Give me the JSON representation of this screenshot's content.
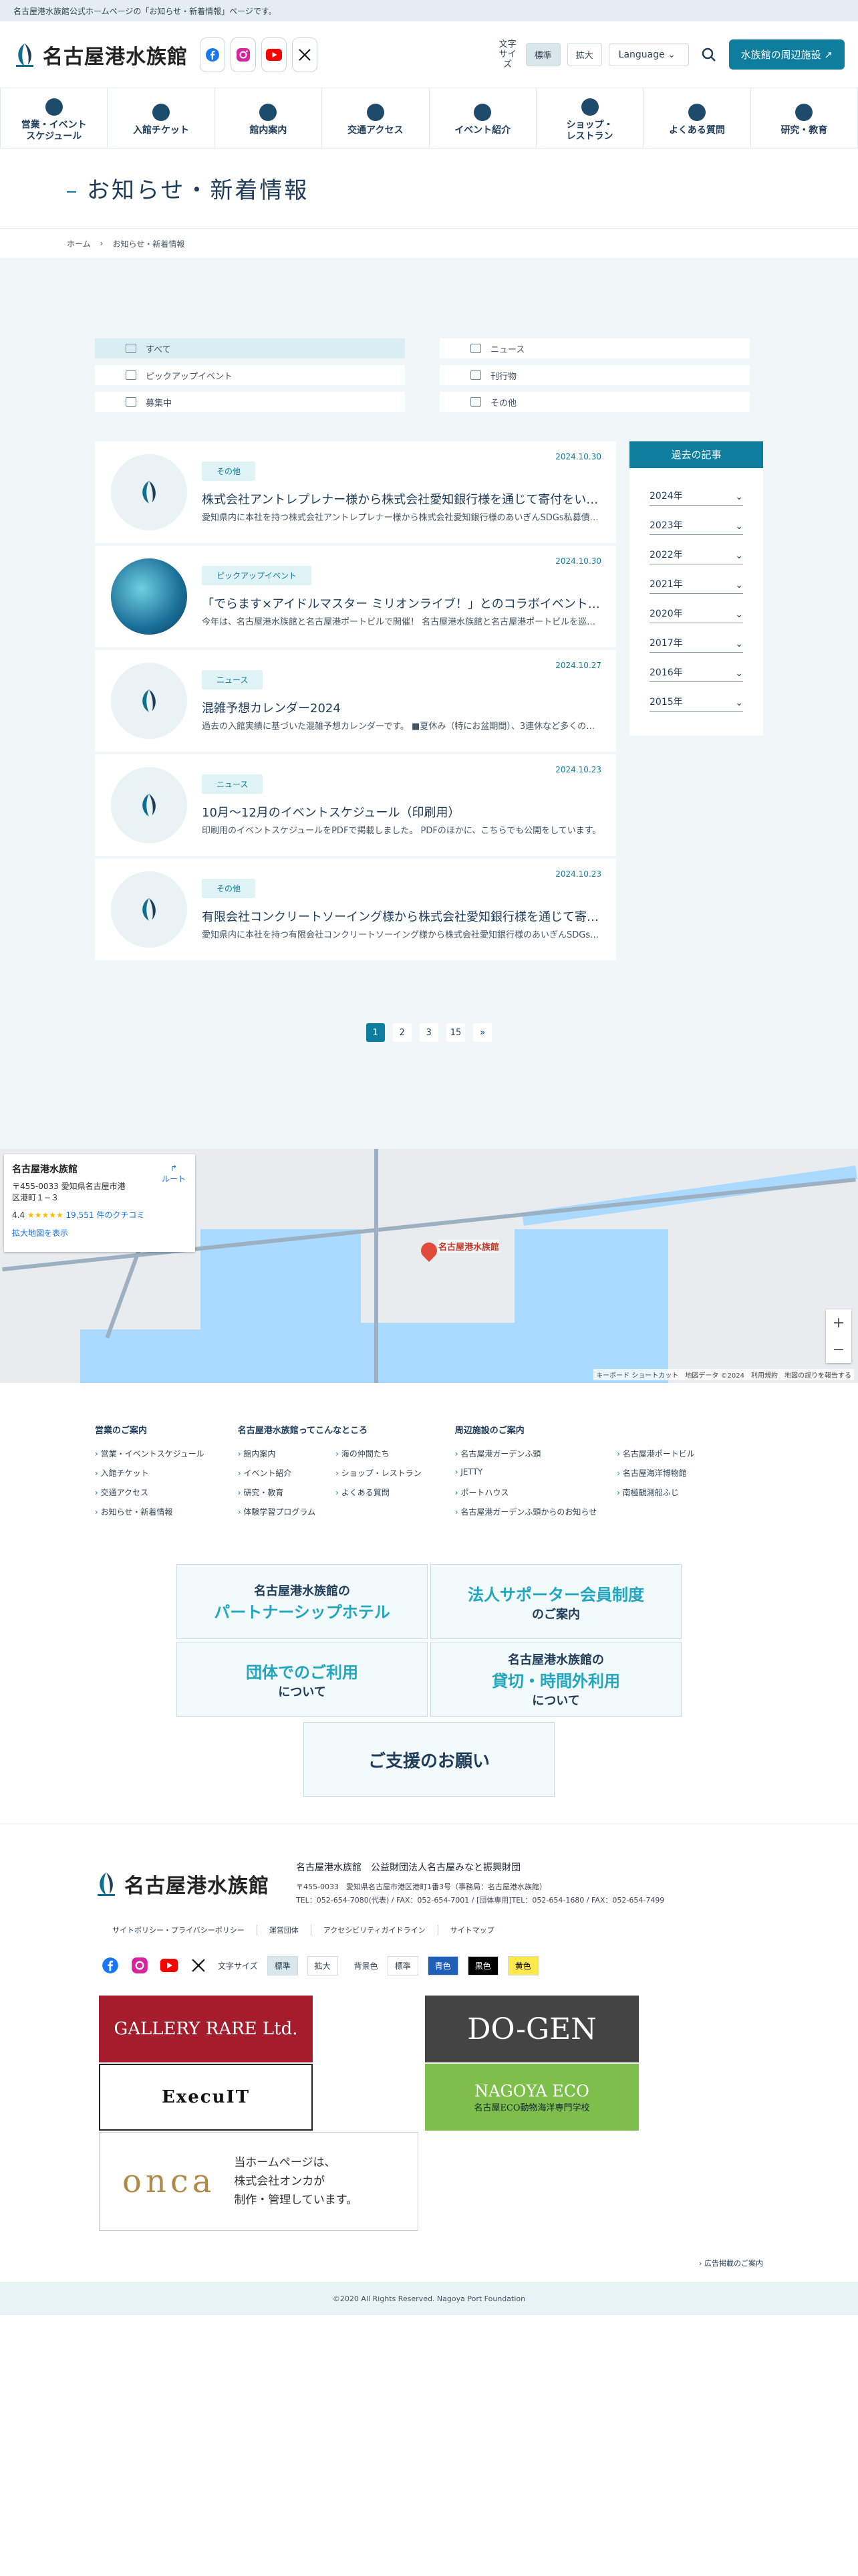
{
  "topbar": "名古屋港水族館公式ホームページの「お知らせ・新着情報」ページです。",
  "header": {
    "logo_text": "名古屋港水族館",
    "font_size_label": "文字サイズ",
    "font_standard": "標準",
    "font_large": "拡大",
    "language": "Language",
    "nearby": "水族館の周辺施設"
  },
  "nav": [
    {
      "label": "営業・イベント\nスケジュール",
      "icon": "clock-icon"
    },
    {
      "label": "入館チケット",
      "icon": "ticket-icon"
    },
    {
      "label": "館内案内",
      "icon": "map-search-icon"
    },
    {
      "label": "交通アクセス",
      "icon": "bus-icon"
    },
    {
      "label": "イベント紹介",
      "icon": "megaphone-icon"
    },
    {
      "label": "ショップ・\nレストラン",
      "icon": "shop-icon"
    },
    {
      "label": "よくある質問",
      "icon": "lightbulb-icon"
    },
    {
      "label": "研究・教育",
      "icon": "globe-icon"
    }
  ],
  "page_title": "お知らせ・新着情報",
  "breadcrumb": {
    "home": "ホーム",
    "current": "お知らせ・新着情報"
  },
  "categories": [
    {
      "label": "すべて",
      "icon": "grid-icon",
      "active": true
    },
    {
      "label": "ニュース",
      "icon": "document-icon",
      "active": false
    },
    {
      "label": "ピックアップイベント",
      "icon": "calendar-icon",
      "active": false
    },
    {
      "label": "刊行物",
      "icon": "book-icon",
      "active": false
    },
    {
      "label": "募集中",
      "icon": "megaphone-icon",
      "active": false
    },
    {
      "label": "その他",
      "icon": "dots-icon",
      "active": false
    }
  ],
  "news": [
    {
      "badge": "その他",
      "date": "2024.10.30",
      "title": "株式会社アントレプレナー様から株式会社愛知銀行様を通じて寄付をいただきました",
      "desc": "愛知県内に本社を持つ株式会社アントレプレナー様から株式会社愛知銀行様のあいぎんSDGs私募債を通じて寄付をいただきました。",
      "photo": false
    },
    {
      "badge": "ピックアップイベント",
      "date": "2024.10.30",
      "title": "「でらます×アイドルマスター ミリオンライブ！」とのコラボイベントを開催します",
      "desc": "今年は、名古屋港水族館と名古屋港ポートビルで開催！ 名古屋港水族館と名古屋港ポートビルを巡るスタンプラリーを実施します。",
      "photo": true
    },
    {
      "badge": "ニュース",
      "date": "2024.10.27",
      "title": "混雑予想カレンダー2024",
      "desc": "過去の入館実績に基づいた混雑予想カレンダーです。 ■夏休み（特にお盆期間）、3連休など多くのお客様にご来館いただく日があります。",
      "photo": false
    },
    {
      "badge": "ニュース",
      "date": "2024.10.23",
      "title": "10月～12月のイベントスケジュール（印刷用）",
      "desc": "印刷用のイベントスケジュールをPDFで掲載しました。 PDFのほかに、こちらでも公開をしています。",
      "photo": false
    },
    {
      "badge": "その他",
      "date": "2024.10.23",
      "title": "有限会社コンクリートソーイング様から株式会社愛知銀行様を通じて寄付をいただきました",
      "desc": "愛知県内に本社を持つ有限会社コンクリートソーイング様から株式会社愛知銀行様のあいぎんSDGs私募債を通じて寄付をいただきました。",
      "photo": false
    }
  ],
  "archive": {
    "title": "過去の記事",
    "years": [
      "2024年",
      "2023年",
      "2022年",
      "2021年",
      "2020年",
      "2017年",
      "2016年",
      "2015年"
    ]
  },
  "pager": [
    "1",
    "2",
    "3",
    "15",
    "»"
  ],
  "map": {
    "name": "名古屋港水族館",
    "address": "〒455-0033 愛知県名古屋市港区港町１−３",
    "route": "ルート",
    "rating": "4.4",
    "stars": "★★★★★",
    "reviews": "19,551 件のクチコミ",
    "larger": "拡大地図を表示",
    "pin_label": "名古屋港水族館",
    "footer": "キーボード ショートカット　地図データ ©2024　利用規約　地図の誤りを報告する",
    "zoom_in": "+",
    "zoom_out": "−"
  },
  "footer_nav": [
    {
      "title": "営業のご案内",
      "cols": 1,
      "links": [
        "営業・イベントスケジュール",
        "入館チケット",
        "交通アクセス",
        "お知らせ・新着情報"
      ]
    },
    {
      "title": "名古屋港水族館ってこんなところ",
      "cols": 2,
      "links": [
        "館内案内",
        "海の仲間たち",
        "イベント紹介",
        "ショップ・レストラン",
        "研究・教育",
        "よくある質問",
        "体験学習プログラム"
      ]
    },
    {
      "title": "周辺施設のご案内",
      "cols": 2,
      "links": [
        "名古屋港ガーデンふ頭",
        "名古屋港ポートビル",
        "JETTY",
        "名古屋海洋博物館",
        "ポートハウス",
        "南極観測船ふじ",
        "名古屋港ガーデンふ頭からのお知らせ"
      ]
    }
  ],
  "banners": [
    {
      "pre": "名古屋港水族館の",
      "hl": "パートナーシップホテル",
      "post": ""
    },
    {
      "pre": "",
      "hl": "法人サポーター会員制度",
      "post": "のご案内"
    },
    {
      "pre": "",
      "hl": "団体でのご利用",
      "post": "について"
    },
    {
      "pre": "名古屋港水族館の",
      "hl": "貸切・時間外利用",
      "post": "について"
    },
    {
      "pre": "",
      "hl": "",
      "post": "ご支援のお願い"
    }
  ],
  "footer_info": {
    "logo_text": "名古屋港水族館",
    "org": "名古屋港水族館　公益財団法人名古屋みなと振興財団",
    "addr1": "〒455-0033　愛知県名古屋市港区港町1番3号（事務局：名古屋港水族館）",
    "addr2": "TEL：052-654-7080(代表) / FAX：052-654-7001 / [団体専用]TEL：052-654-1680 / FAX：052-654-7499"
  },
  "footer_links": [
    "サイトポリシー・プライバシーポリシー",
    "運営団体",
    "アクセシビリティガイドライン",
    "サイトマップ"
  ],
  "footer_tools": {
    "font_size": "文字サイズ",
    "standard": "標準",
    "large": "拡大",
    "bg_color": "背景色",
    "bg_standard": "標準",
    "bg_blue": "青色",
    "bg_black": "黒色",
    "bg_yellow": "黄色"
  },
  "ads": {
    "gallery": "GALLERY RARE Ltd.",
    "execuit": "ExecuIT",
    "dogen": "DO-GEN",
    "eco": "NAGOYA ECO",
    "eco_sub": "名古屋ECO動物海洋専門学校",
    "onca_logo": "onca",
    "onca_text1": "当ホームページは、",
    "onca_text2": "株式会社オンカが",
    "onca_text3": "制作・管理しています。"
  },
  "ad_link": "広告掲載のご案内",
  "copyright": "©2020 All Rights Reserved. Nagoya Port Foundation",
  "colors": {
    "accent": "#0f7e9e",
    "navy": "#1f3d5a",
    "bg_light": "#f1f7f9"
  }
}
